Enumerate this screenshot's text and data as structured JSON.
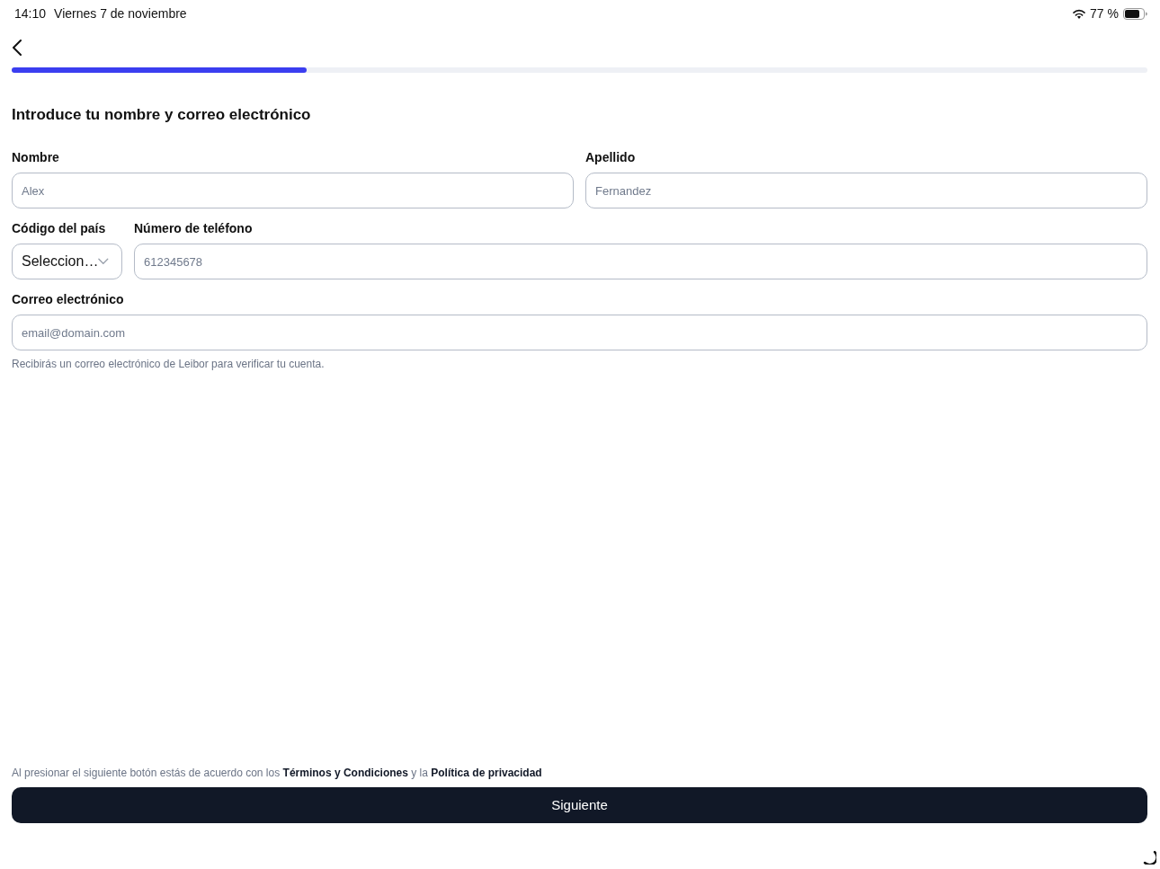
{
  "status_bar": {
    "time": "14:10",
    "date": "Viernes 7 de noviembre",
    "battery": "77 %"
  },
  "progress": {
    "level": 0.26
  },
  "title": "Introduce tu nombre y correo electrónico",
  "rows": [
    [
      {
        "kind": "text",
        "label": "Nombre",
        "placeholder": "Alex"
      },
      {
        "kind": "text",
        "label": "Apellido",
        "placeholder": "Fernandez"
      }
    ],
    [
      {
        "kind": "select",
        "label": "Código del país",
        "value": "Seleccion…"
      },
      {
        "kind": "text",
        "label": "Número de teléfono",
        "placeholder": "612345678"
      }
    ],
    [
      {
        "kind": "text",
        "label": "Correo electrónico",
        "placeholder": "email@domain.com",
        "hint": "Recibirás un correo electrónico de Leibor para verificar tu cuenta."
      }
    ]
  ],
  "terms": [
    {
      "kind": "text",
      "text": "Al presionar el siguiente botón estás de acuerdo con los"
    },
    {
      "kind": "link",
      "text": "Términos y Condiciones"
    },
    {
      "kind": "text",
      "text": "y la"
    },
    {
      "kind": "link",
      "text": "Política de privacidad"
    }
  ],
  "button": "Siguiente"
}
